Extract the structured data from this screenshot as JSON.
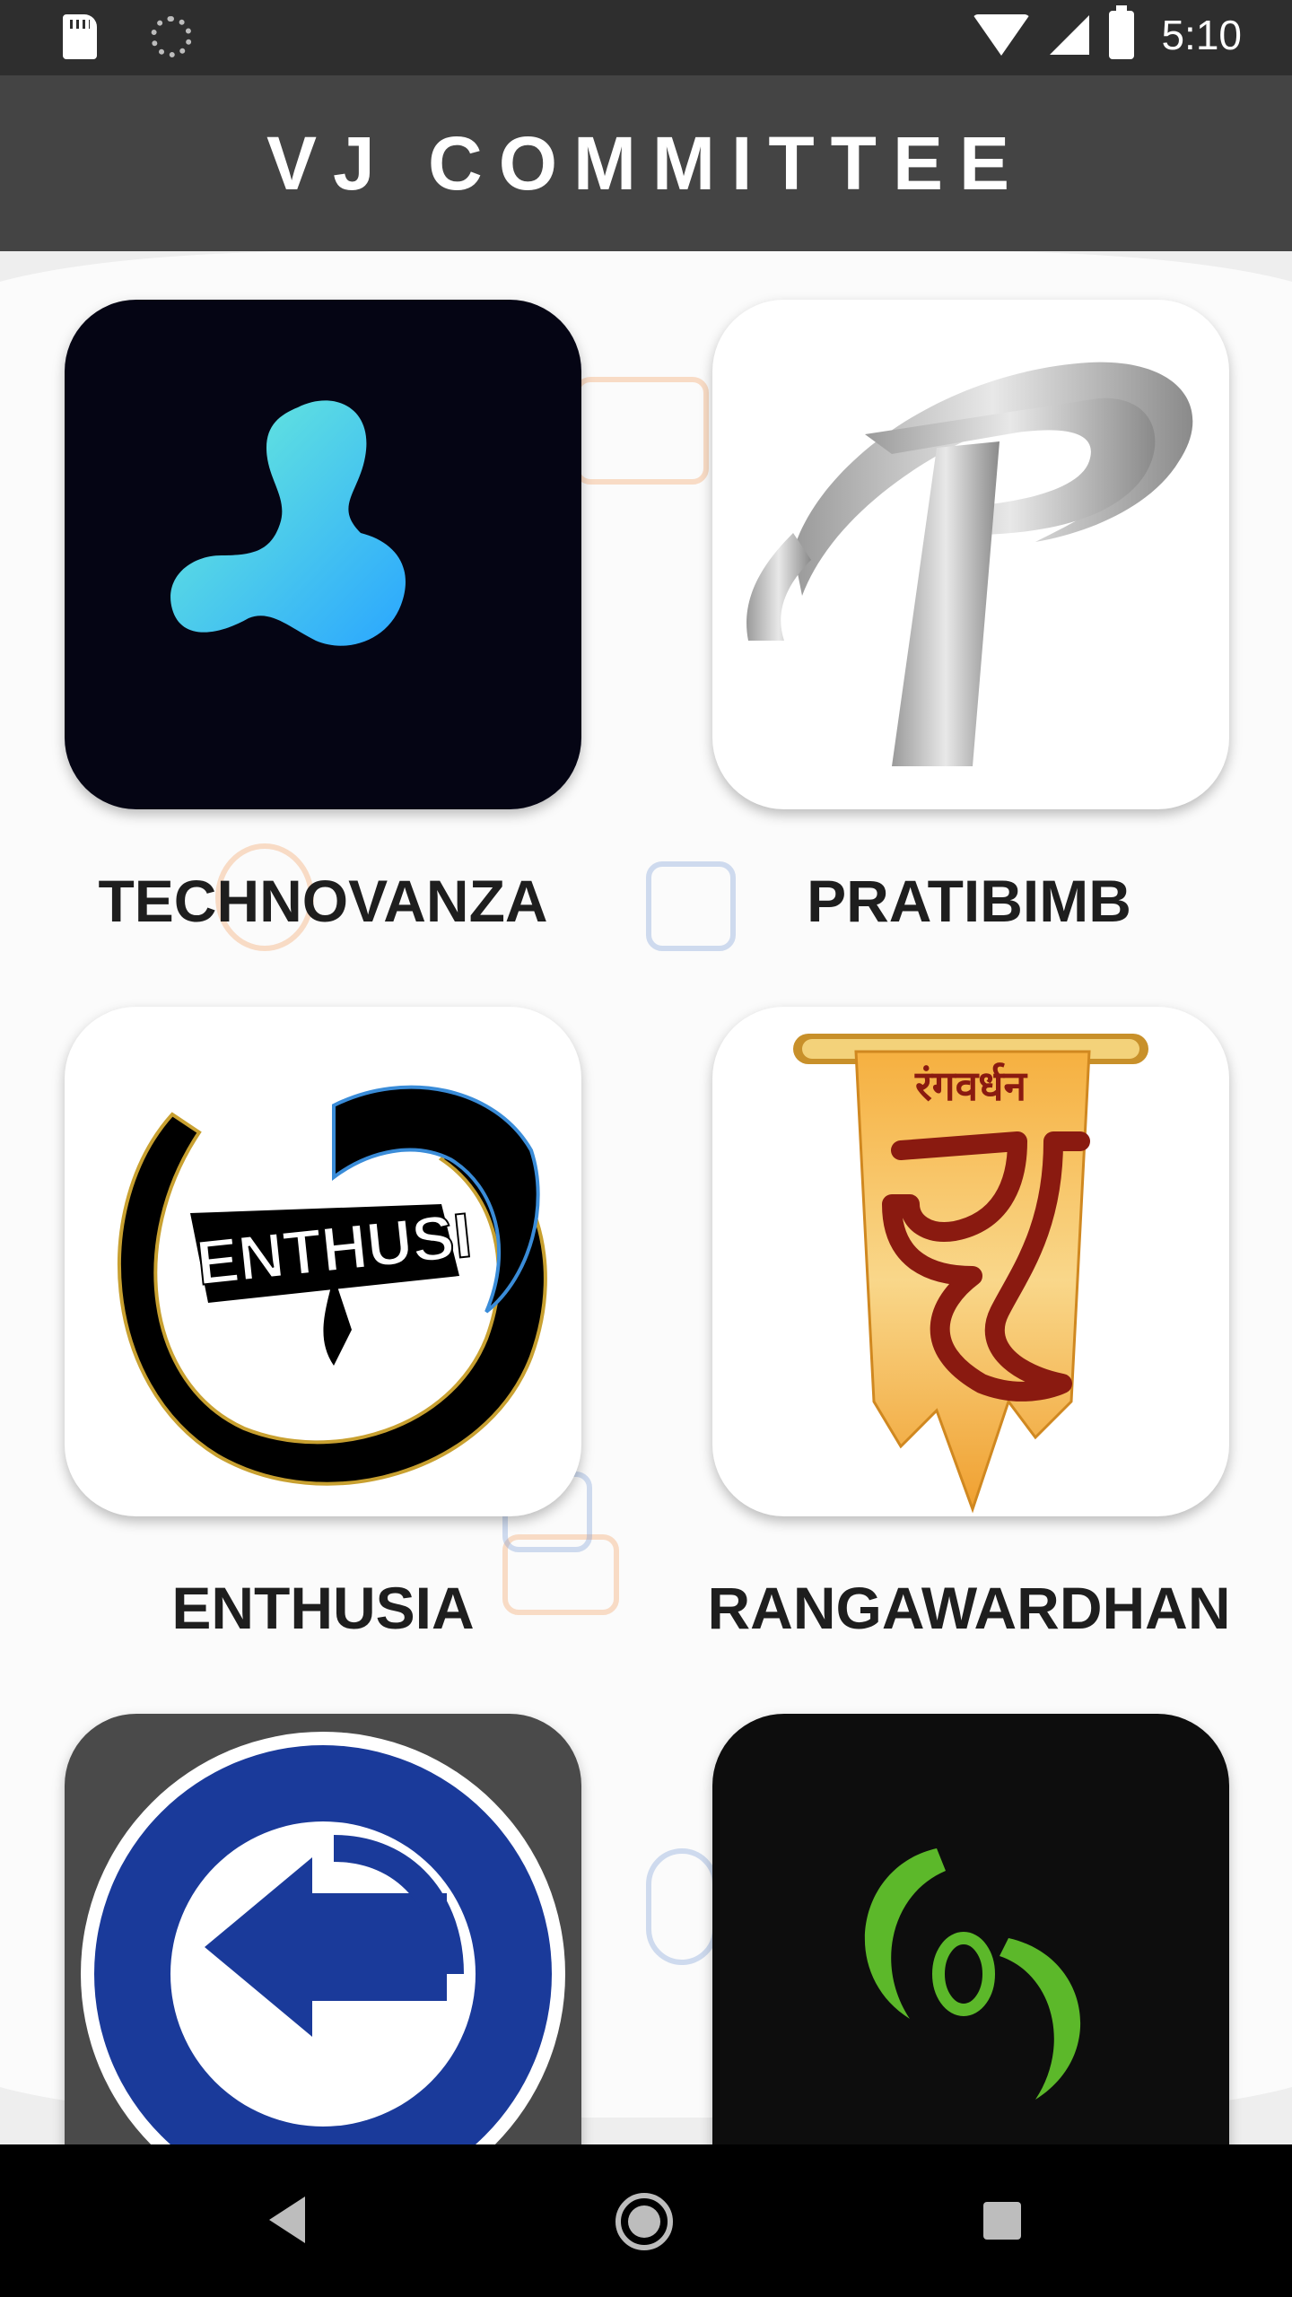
{
  "status_bar": {
    "time": "5:10",
    "icons": [
      "sd-card-icon",
      "sync-icon",
      "wifi-icon",
      "signal-icon",
      "battery-icon"
    ]
  },
  "app_bar": {
    "title": "VJ COMMITTEE"
  },
  "committees": [
    {
      "name": "TECHNOVANZA",
      "logo": "technovanza-logo",
      "logo_bg": "#050514"
    },
    {
      "name": "PRATIBIMB",
      "logo": "pratibimb-logo",
      "logo_bg": "#ffffff"
    },
    {
      "name": "ENTHUSIA",
      "logo": "enthusia-logo",
      "logo_bg": "#ffffff"
    },
    {
      "name": "RANGAWARDHAN",
      "logo": "rangawardhan-logo",
      "logo_bg": "#ffffff"
    },
    {
      "name": "",
      "logo": "committee-5-logo",
      "logo_bg": "#4a4a4a"
    },
    {
      "name": "",
      "logo": "committee-6-logo",
      "logo_bg": "#0d0d0d"
    }
  ],
  "rangawardhan_logo_text": "रंगवर्धन",
  "colors": {
    "status_bar": "#2e2e2e",
    "app_bar": "#444444",
    "technovanza_accent": "#39c6f0",
    "committee6_accent": "#5cb82a"
  },
  "nav_bar": {
    "icons": [
      "back-icon",
      "home-icon",
      "recent-apps-icon"
    ]
  }
}
